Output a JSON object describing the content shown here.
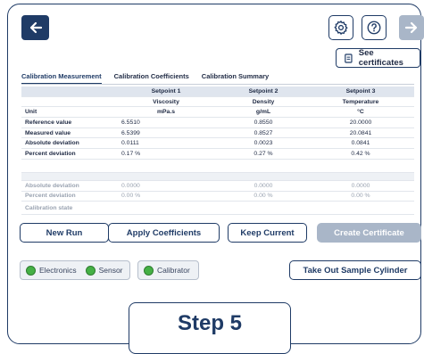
{
  "header": {
    "see_certificates_label": "See certificates",
    "colors": {
      "primary": "#1f3b66",
      "disabled": "#a9b6c8",
      "status_ok": "#45b045"
    }
  },
  "tabs": [
    {
      "label": "Calibration Measurement",
      "active": true
    },
    {
      "label": "Calibration Coefficients",
      "active": false
    },
    {
      "label": "Calibration Summary",
      "active": false
    }
  ],
  "table": {
    "setpoints": [
      "Setpoint 1",
      "Setpoint 2",
      "Setpoint 3"
    ],
    "quantities": [
      "Viscosity",
      "Density",
      "Temperature"
    ],
    "rows": [
      {
        "label": "Unit",
        "values": [
          "mPa.s",
          "g/mL",
          "°C"
        ]
      },
      {
        "label": "Reference value",
        "values": [
          "6.5510",
          "0.8550",
          "20.0000"
        ]
      },
      {
        "label": "Measured value",
        "values": [
          "6.5399",
          "0.8527",
          "20.0841"
        ]
      },
      {
        "label": "Absolute deviation",
        "values": [
          "0.0111",
          "0.0023",
          "0.0841"
        ]
      },
      {
        "label": "Percent deviation",
        "values": [
          "0.17 %",
          "0.27 %",
          "0.42 %"
        ]
      }
    ],
    "grey_rows": [
      {
        "label": "Absolute deviation",
        "values": [
          "0.0000",
          "0.0000",
          "0.0000"
        ]
      },
      {
        "label": "Percent deviation",
        "values": [
          "0.00 %",
          "0.00 %",
          "0.00 %"
        ]
      },
      {
        "label": "Calibration state",
        "values": [
          "",
          "",
          ""
        ]
      }
    ]
  },
  "actions": {
    "new_run": "New Run",
    "apply_coefficients": "Apply Coefficients",
    "keep_current": "Keep Current",
    "create_certificate": "Create Certificate",
    "take_out": "Take Out Sample Cylinder"
  },
  "status": {
    "electronics": "Electronics",
    "sensor": "Sensor",
    "calibrator": "Calibrator"
  },
  "step_label": "Step 5"
}
